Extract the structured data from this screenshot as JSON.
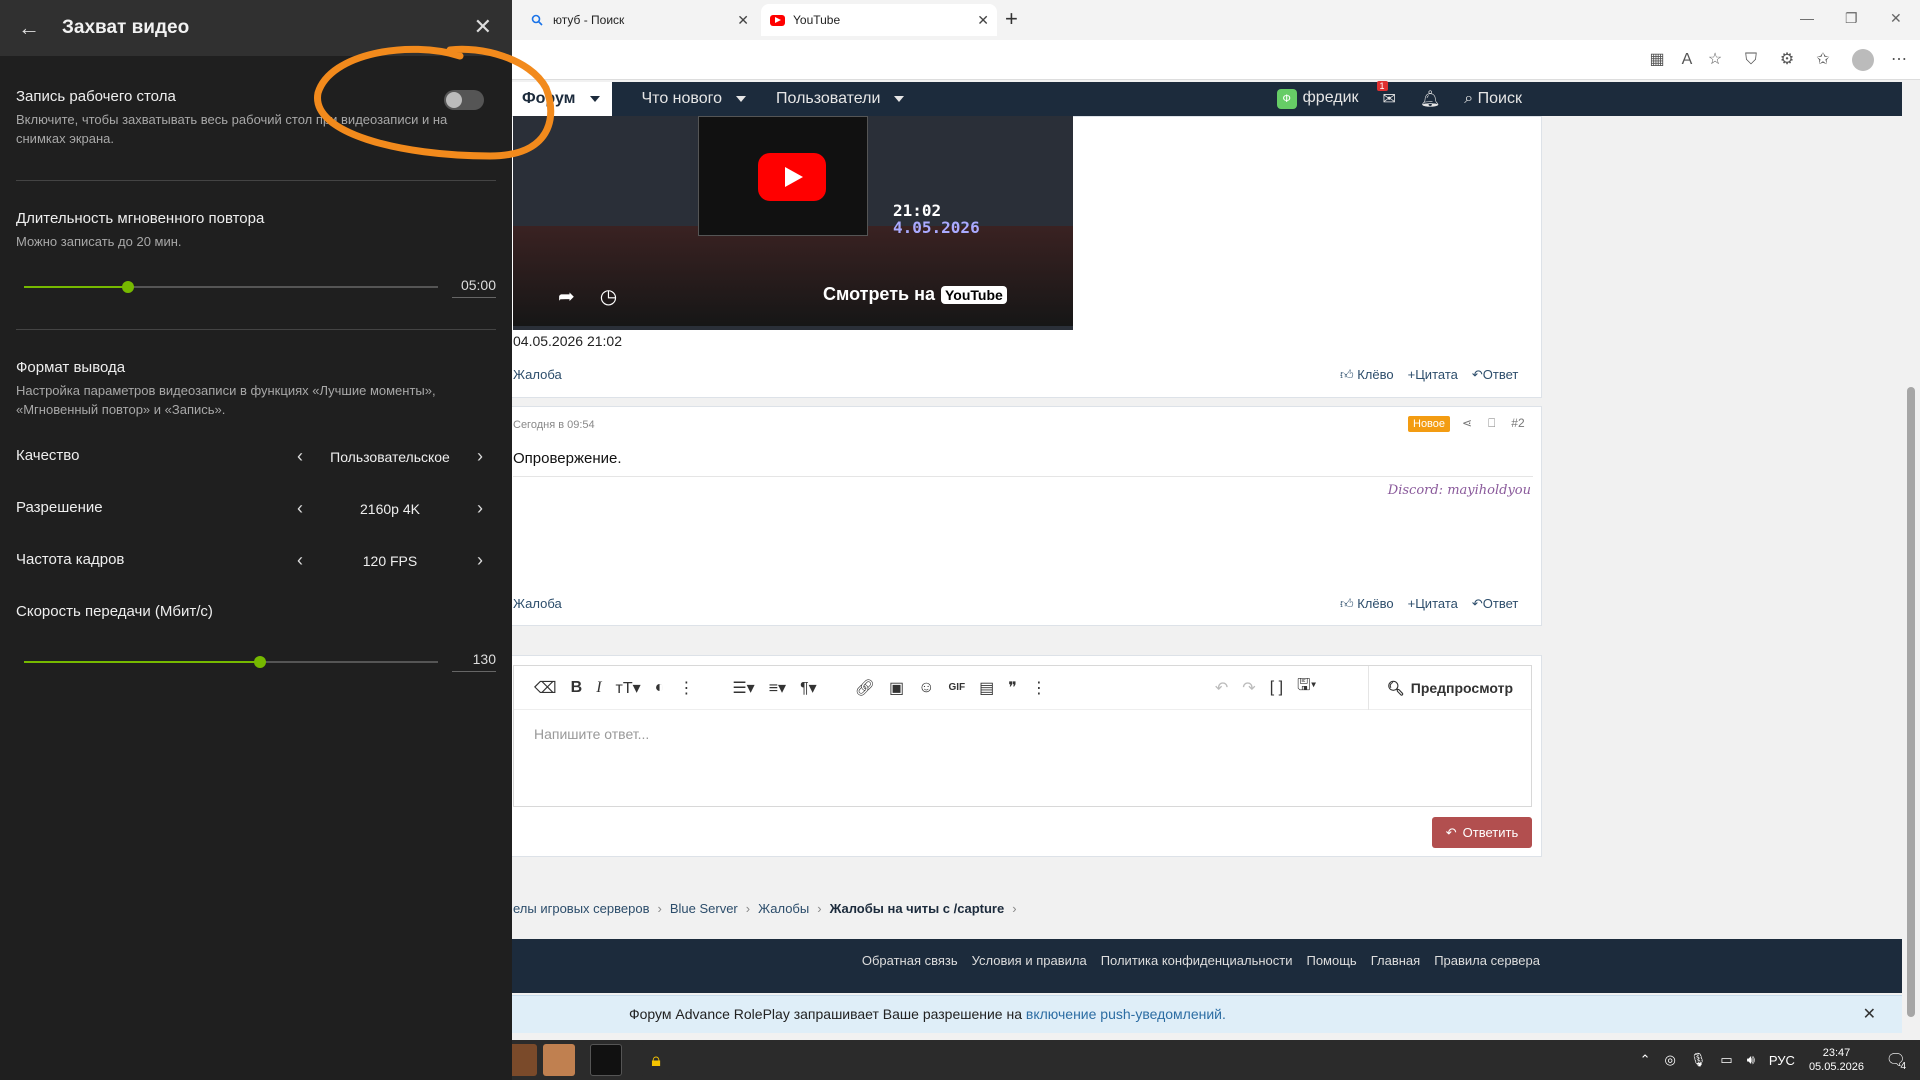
{
  "browser": {
    "tabs": [
      {
        "label": "ютуб - Поиск",
        "icon": "search-icon"
      },
      {
        "label": "YouTube",
        "icon": "youtube-icon"
      }
    ],
    "new_tab": "+",
    "window_controls": [
      "—",
      "❐",
      "✕"
    ]
  },
  "forum_nav": {
    "items": [
      {
        "label": "Форум"
      },
      {
        "label": "Что нового"
      },
      {
        "label": "Пользователи"
      }
    ],
    "user": "фредик",
    "user_badge": "Ф",
    "mail_count": "1",
    "search": "Поиск"
  },
  "post1": {
    "video_watch": "Смотреть на",
    "video_logo": "YouTube",
    "video_clock": "21:02",
    "video_date": "4.05.2026",
    "date": "04.05.2026 21:02",
    "report": "Жалоба",
    "actions": {
      "like": "Клёво",
      "quote": "Цитата",
      "reply": "Ответ"
    }
  },
  "post2": {
    "meta": "Сегодня в 09:54",
    "badge": "Новое",
    "number": "#2",
    "body": "Опровержение.",
    "signature": "Discord: mayiholdyou",
    "report": "Жалоба",
    "actions": {
      "like": "Клёво",
      "quote": "Цитата",
      "reply": "Ответ"
    }
  },
  "editor": {
    "placeholder": "Напишите ответ...",
    "preview": "Предпросмотр",
    "submit": "Ответить"
  },
  "breadcrumbs": [
    "елы игровых серверов",
    "Blue Server",
    "Жалобы",
    "Жалобы на читы с /capture"
  ],
  "footer": {
    "links": [
      "Обратная связь",
      "Условия и правила",
      "Политика конфиденциальности",
      "Помощь",
      "Главная",
      "Правила сервера"
    ]
  },
  "push": {
    "text": "Форум Advance RolePlay запрашивает Ваше разрешение на",
    "link": "включение push-уведомлений."
  },
  "overlay": {
    "title": "Захват видео",
    "desktop_capture": {
      "label": "Запись рабочего стола",
      "desc": "Включите, чтобы захватывать весь рабочий стол при видеозаписи и на снимках экрана.",
      "enabled": false
    },
    "instant_replay": {
      "label": "Длительность мгновенного повтора",
      "desc": "Можно записать до 20 мин.",
      "value": "05:00",
      "fraction": 0.25
    },
    "output_format": {
      "label": "Формат вывода",
      "desc": "Настройка параметров видеозаписи в функциях «Лучшие моменты», «Мгновенный повтор» и «Запись»."
    },
    "quality": {
      "label": "Качество",
      "value": "Пользовательское"
    },
    "resolution": {
      "label": "Разрешение",
      "value": "2160p 4K"
    },
    "framerate": {
      "label": "Частота кадров",
      "value": "120 FPS"
    },
    "bitrate": {
      "label": "Скорость передачи (Мбит/с)",
      "value": "130",
      "fraction": 0.57
    }
  },
  "taskbar": {
    "lang": "РУС",
    "time": "23:47",
    "date": "05.05.2026",
    "notif_count": "4"
  },
  "colors": {
    "accent_green": "#76b900",
    "forum_dark": "#1c2b3c",
    "annotation": "#f28a1c",
    "new_badge": "#f39c12",
    "reply_button": "#b24f4f"
  }
}
